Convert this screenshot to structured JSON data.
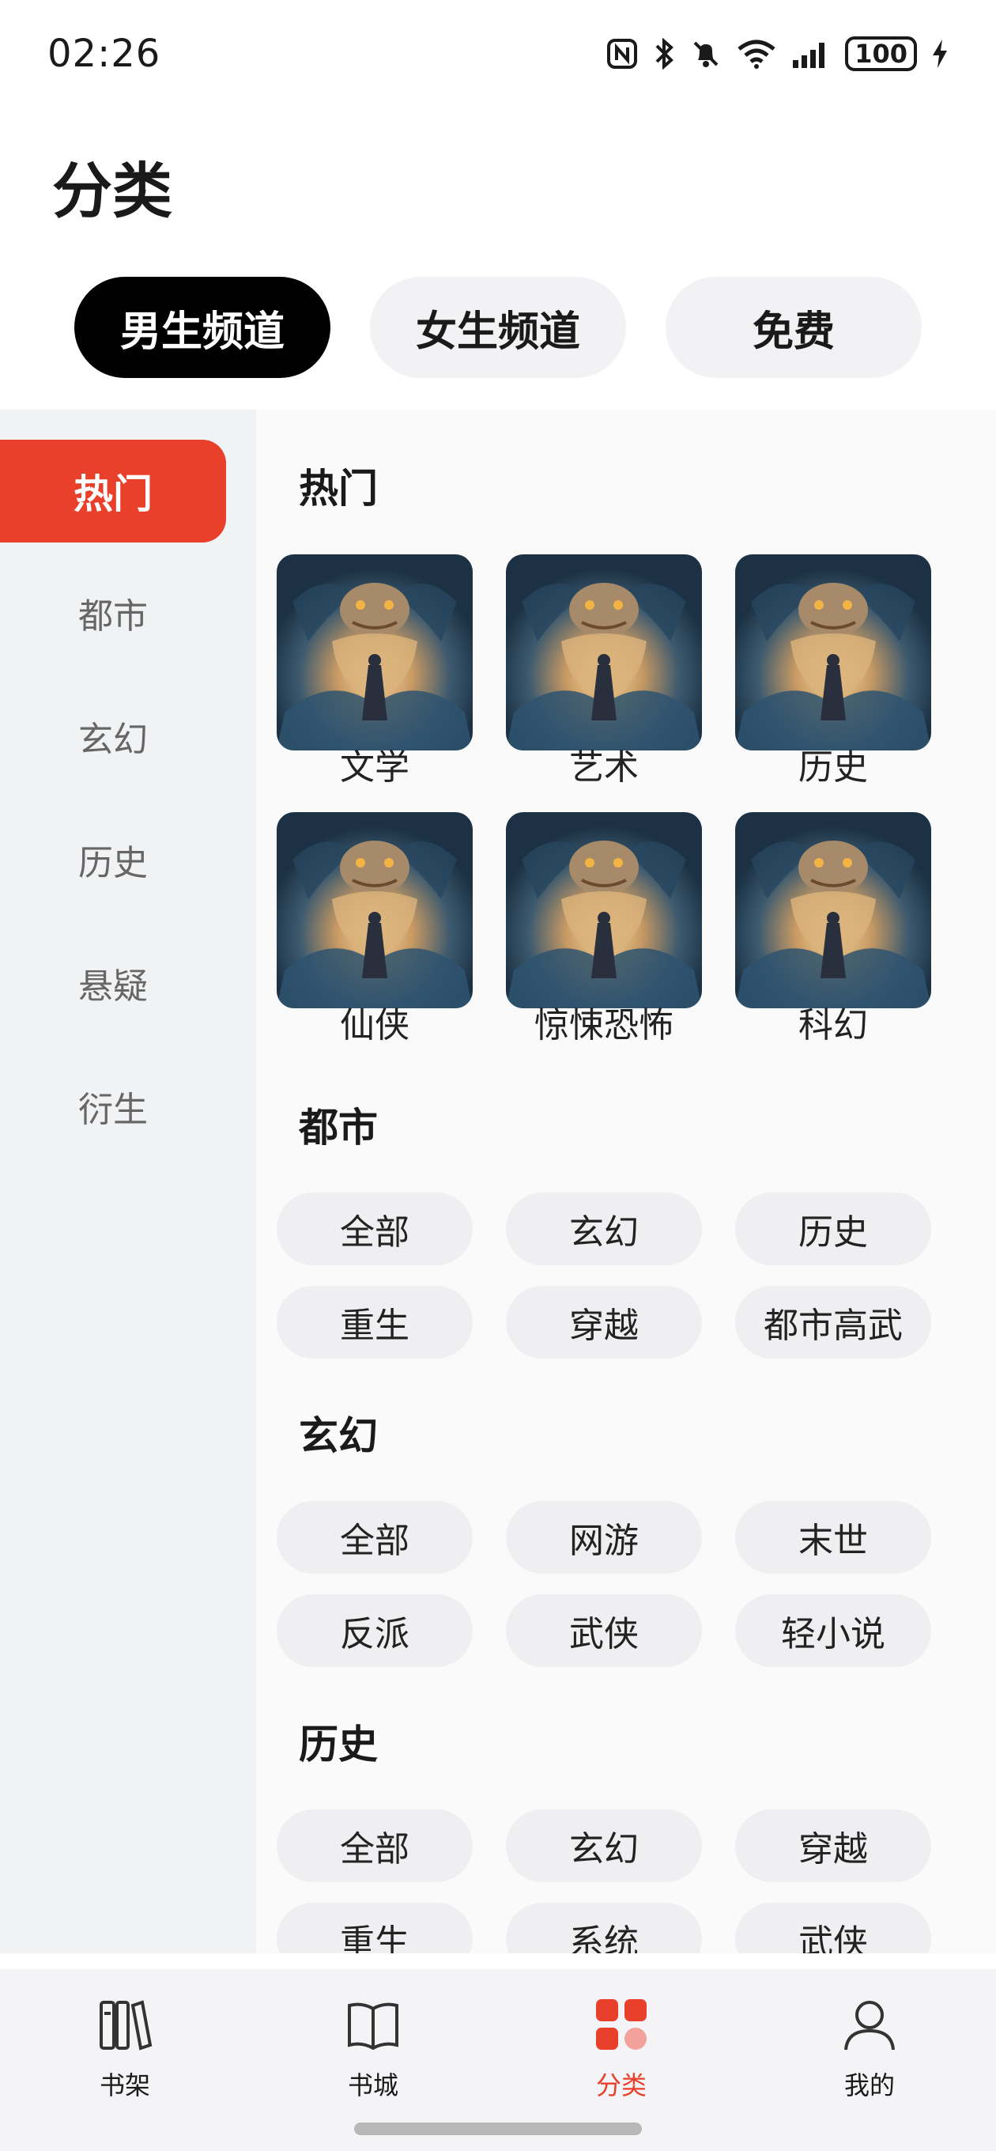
{
  "status": {
    "time": "02:26",
    "battery": "100"
  },
  "header": {
    "title": "分类"
  },
  "channels": [
    {
      "label": "男生频道",
      "active": true
    },
    {
      "label": "女生频道",
      "active": false
    },
    {
      "label": "免费",
      "active": false
    }
  ],
  "sidebar": {
    "items": [
      {
        "label": "热门",
        "active": true
      },
      {
        "label": "都市",
        "active": false
      },
      {
        "label": "玄幻",
        "active": false
      },
      {
        "label": "历史",
        "active": false
      },
      {
        "label": "悬疑",
        "active": false
      },
      {
        "label": "衍生",
        "active": false
      }
    ]
  },
  "content": {
    "hot": {
      "title": "热门",
      "items": [
        "文学",
        "艺术",
        "历史",
        "仙侠",
        "惊悚恐怖",
        "科幻"
      ]
    },
    "urban": {
      "title": "都市",
      "tags": [
        "全部",
        "玄幻",
        "历史",
        "重生",
        "穿越",
        "都市高武"
      ]
    },
    "fantasy": {
      "title": "玄幻",
      "tags": [
        "全部",
        "网游",
        "末世",
        "反派",
        "武侠",
        "轻小说"
      ]
    },
    "history": {
      "title": "历史",
      "tags": [
        "全部",
        "玄幻",
        "穿越",
        "重生",
        "系统",
        "武侠"
      ]
    }
  },
  "bottom_nav": {
    "items": [
      {
        "label": "书架",
        "icon": "bookshelf-icon"
      },
      {
        "label": "书城",
        "icon": "book-open-icon"
      },
      {
        "label": "分类",
        "icon": "category-grid-icon",
        "active": true
      },
      {
        "label": "我的",
        "icon": "profile-icon"
      }
    ]
  },
  "colors": {
    "accent": "#e8402a",
    "active_tab": "#000000",
    "pill_bg": "#efeff1",
    "sidebar_bg": "#f1f2f4"
  }
}
